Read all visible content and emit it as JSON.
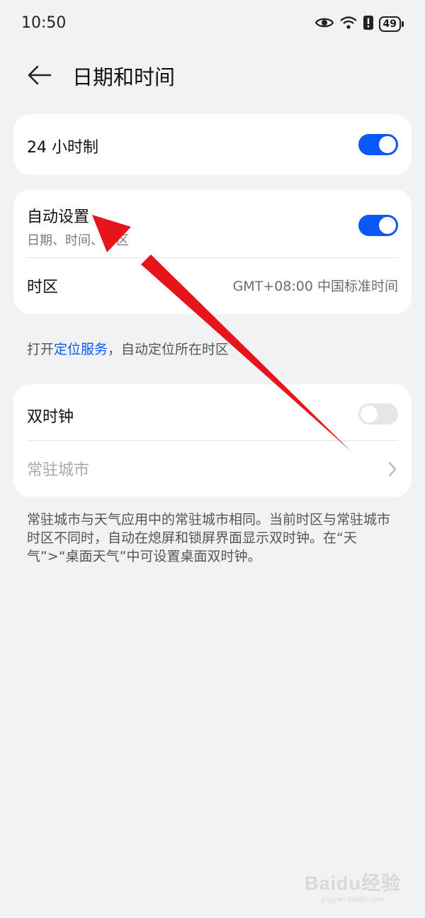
{
  "status_bar": {
    "time": "10:50",
    "battery": "49"
  },
  "header": {
    "title": "日期和时间"
  },
  "hour24": {
    "label": "24 小时制",
    "enabled": true
  },
  "auto_set": {
    "label": "自动设置",
    "sublabel": "日期、时间、时区",
    "enabled": true,
    "timezone_label": "时区",
    "timezone_value": "GMT+08:00 中国标准时间"
  },
  "location_note": {
    "prefix": "打开",
    "link": "定位服务",
    "suffix": "，自动定位所在时区"
  },
  "dual_clock": {
    "label": "双时钟",
    "enabled": false,
    "city_label": "常驻城市"
  },
  "footnote": "常驻城市与天气应用中的常驻城市相同。当前时区与常驻城市时区不同时，自动在熄屏和锁屏界面显示双时钟。在“天气”>“桌面天气”中可设置桌面双时钟。",
  "watermark": {
    "brand": "Baidu经验",
    "sub": "jingyan.baidu.com"
  },
  "colors": {
    "accent": "#0a59f7",
    "annotation_arrow": "#e8141c",
    "background": "#f1f2f4"
  }
}
